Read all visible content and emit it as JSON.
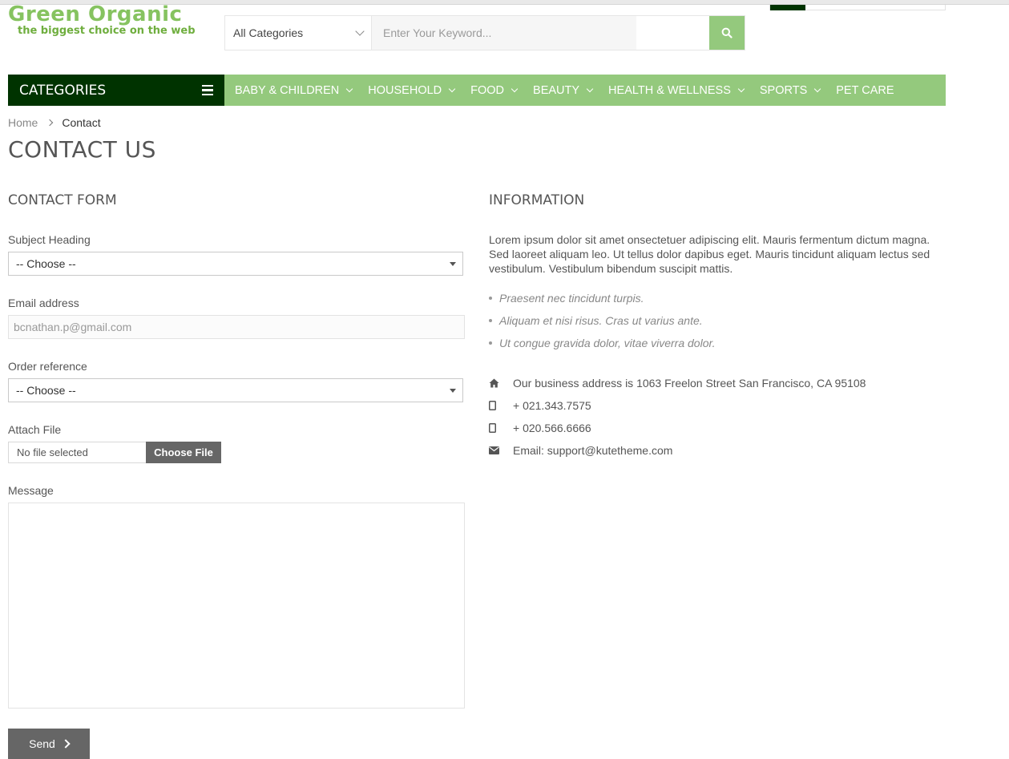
{
  "header": {
    "logo_title": "Green Organic",
    "logo_tagline": "the biggest choice on the web",
    "search_category": "All Categories",
    "search_placeholder": "Enter Your Keyword..."
  },
  "nav": {
    "categories_label": "CATEGORIES",
    "items": [
      {
        "label": "BABY & CHILDREN",
        "has_dropdown": true
      },
      {
        "label": "HOUSEHOLD",
        "has_dropdown": true
      },
      {
        "label": "FOOD",
        "has_dropdown": true
      },
      {
        "label": "BEAUTY",
        "has_dropdown": true
      },
      {
        "label": "HEALTH & WELLNESS",
        "has_dropdown": true
      },
      {
        "label": "SPORTS",
        "has_dropdown": true
      },
      {
        "label": "PET CARE",
        "has_dropdown": false
      }
    ]
  },
  "breadcrumb": {
    "home": "Home",
    "current": "Contact"
  },
  "page_title": "CONTACT US",
  "form": {
    "heading": "CONTACT FORM",
    "subject_label": "Subject Heading",
    "subject_value": "-- Choose --",
    "email_label": "Email address",
    "email_value": "bcnathan.p@gmail.com",
    "order_label": "Order reference",
    "order_value": "-- Choose --",
    "attach_label": "Attach File",
    "file_name": "No file selected",
    "file_button": "Choose File",
    "message_label": "Message",
    "message_value": "",
    "send_label": "Send"
  },
  "info": {
    "heading": "INFORMATION",
    "paragraph": "Lorem ipsum dolor sit amet onsectetuer adipiscing elit. Mauris fermentum dictum magna. Sed laoreet aliquam leo. Ut tellus dolor dapibus eget. Mauris tincidunt aliquam lectus sed vestibulum. Vestibulum bibendum suscipit mattis.",
    "bullets": [
      "Praesent nec tincidunt turpis.",
      "Aliquam et nisi risus. Cras ut varius ante.",
      "Ut congue gravida dolor, vitae viverra dolor."
    ],
    "address": "Our business address is 1063 Freelon Street San Francisco, CA 95108",
    "phone1": "+ 021.343.7575",
    "phone2": "+ 020.566.6666",
    "email": "Email: support@kutetheme.com"
  },
  "colors": {
    "brand_green": "#94c97d",
    "dark_green": "#003300",
    "button_gray": "#666666"
  },
  "icons": [
    "search-icon",
    "menu-icon",
    "chevron-down-icon",
    "home-icon",
    "mobile-icon",
    "envelope-icon",
    "arrow-right-icon"
  ]
}
